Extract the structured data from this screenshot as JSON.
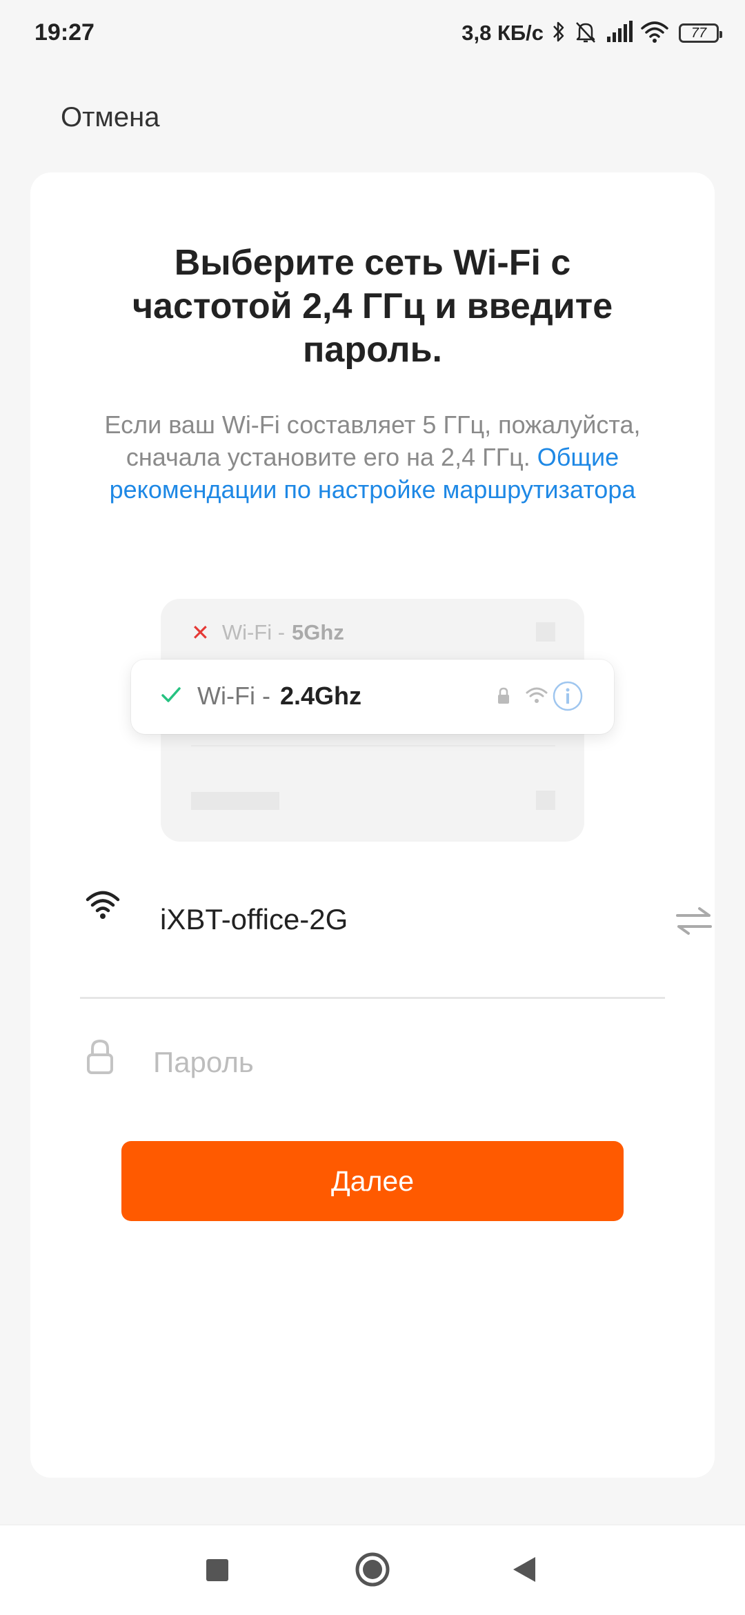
{
  "status_bar": {
    "time": "19:27",
    "speed": "3,8 КБ/с",
    "battery": "77",
    "icons": [
      "bluetooth-icon",
      "mute-bell-icon",
      "signal-icon",
      "wifi-icon",
      "battery-icon"
    ]
  },
  "header": {
    "cancel_label": "Отмена"
  },
  "main": {
    "title": "Выберите сеть Wi-Fi с частотой 2,4 ГГц и введите пароль.",
    "description": "Если ваш Wi-Fi составляет 5 ГГц, пожалуйста, сначала установите его на 2,4 ГГц.",
    "description_link": "Общие рекомендации по настройке маршрутизатора",
    "illustration": {
      "bad_prefix": "Wi-Fi -",
      "bad_band": "5Ghz",
      "good_prefix": "Wi-Fi -",
      "good_band": "2.4Ghz"
    },
    "ssid": "iXBT-office-2G",
    "password_placeholder": "Пароль",
    "next_label": "Далее"
  },
  "colors": {
    "accent": "#ff5a00",
    "link": "#1e88e5",
    "check": "#26c281",
    "cross": "#e53935"
  }
}
